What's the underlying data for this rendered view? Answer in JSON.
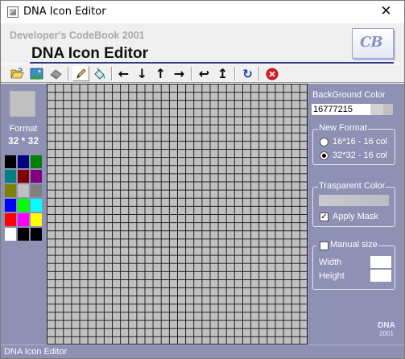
{
  "window": {
    "title": "DNA Icon Editor",
    "close_glyph": "✕"
  },
  "banner": {
    "subtitle": "Developer's CodeBook 2001",
    "title": "DNA Icon Editor",
    "logo_text": "CB"
  },
  "toolbar": {
    "buttons": [
      {
        "name": "open-icon",
        "glyph": "open"
      },
      {
        "name": "image-icon",
        "glyph": "image"
      },
      {
        "name": "eraser-icon",
        "glyph": "eraser"
      },
      {
        "name": "pencil-icon",
        "glyph": "pencil",
        "pressed": true
      },
      {
        "name": "fill-icon",
        "glyph": "fill"
      },
      {
        "name": "arrow-left-icon",
        "glyph": "←"
      },
      {
        "name": "arrow-down-icon",
        "glyph": "↓"
      },
      {
        "name": "arrow-up-icon",
        "glyph": "↑"
      },
      {
        "name": "arrow-right-icon",
        "glyph": "→"
      },
      {
        "name": "flip-horizontal-icon",
        "glyph": "↩"
      },
      {
        "name": "flip-vertical-icon",
        "glyph": "↥"
      },
      {
        "name": "rotate-icon",
        "glyph": "↻"
      },
      {
        "name": "clear-icon",
        "glyph": "✕"
      }
    ]
  },
  "left_panel": {
    "format_label": "Format",
    "format_value": "32 * 32",
    "palette": [
      "#000000",
      "#000080",
      "#008000",
      "#008080",
      "#800000",
      "#800080",
      "#808000",
      "#c0c0c0",
      "#808080",
      "#0000ff",
      "#00ff00",
      "#00ffff",
      "#ff0000",
      "#ff00ff",
      "#ffff00",
      "#ffffff",
      "#000000",
      "#000000"
    ]
  },
  "canvas": {
    "background_color": "#c0c0c0",
    "grid_color": "#222222"
  },
  "right_panel": {
    "background_color_label": "BackGround Color",
    "background_color_value": "16777215",
    "new_format_legend": "New Format",
    "format_options": [
      {
        "label": "16*16 - 16 col",
        "checked": false
      },
      {
        "label": "32*32 - 16 col",
        "checked": true
      }
    ],
    "transparent_legend": "Trasparent Color",
    "apply_mask_label": "Apply Mask",
    "apply_mask_checked": true,
    "manual_size_label": "Manual size",
    "manual_size_checked": false,
    "width_label": "Width",
    "height_label": "Height",
    "width_value": "",
    "height_value": "",
    "logo_line1": "DNA",
    "logo_line2": "2001"
  },
  "status": {
    "text": "DNA Icon Editor"
  },
  "colors": {
    "panel": "#8e90b4",
    "accent": "#2f3a8f"
  }
}
